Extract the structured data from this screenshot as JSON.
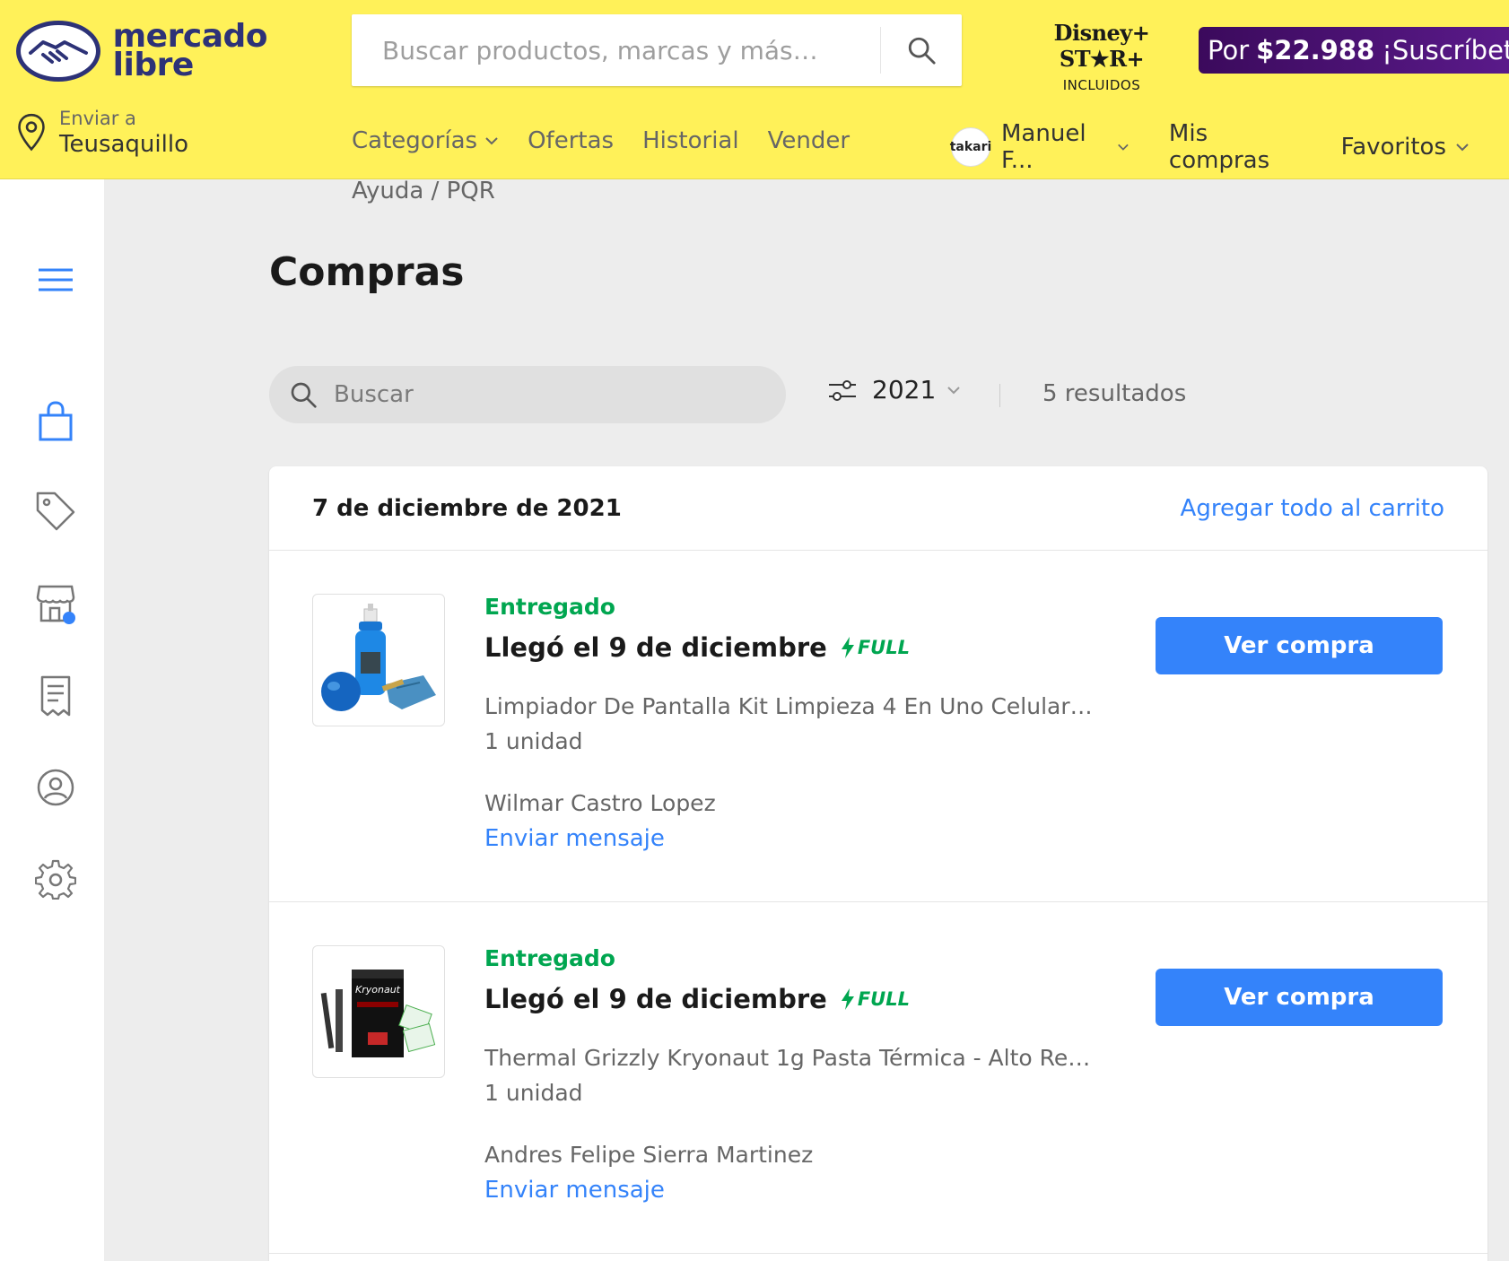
{
  "header": {
    "logo": {
      "line1": "mercado",
      "line2": "libre"
    },
    "search_placeholder": "Buscar productos, marcas y más…",
    "disney": {
      "brand": "Disney+ ST★R+",
      "included": "INCLUIDOS"
    },
    "promo": {
      "prefix": "Por",
      "price": "$22.988",
      "cta": "¡Suscríbete"
    },
    "ship": {
      "label": "Enviar a",
      "location": "Teusaquillo"
    },
    "nav": [
      "Categorías",
      "Ofertas",
      "Historial",
      "Vender"
    ],
    "help": "Ayuda / PQR",
    "user": {
      "avatar_text": "takari",
      "name": "Manuel F..."
    },
    "my_purchases": "Mis compras",
    "favorites": "Favoritos"
  },
  "page": {
    "title": "Compras",
    "search_placeholder": "Buscar",
    "year": "2021",
    "results": "5 resultados"
  },
  "group": {
    "date": "7 de diciembre de 2021",
    "add_all": "Agregar todo al carrito",
    "orders": [
      {
        "status": "Entregado",
        "arrival": "Llegó el 9 de diciembre",
        "badge": "FULL",
        "product": "Limpiador De Pantalla Kit Limpieza 4 En Uno Celular, ...",
        "qty": "1 unidad",
        "seller": "Wilmar Castro Lopez",
        "message": "Enviar mensaje",
        "button": "Ver compra"
      },
      {
        "status": "Entregado",
        "arrival": "Llegó el 9 de diciembre",
        "badge": "FULL",
        "product": "Thermal Grizzly Kryonaut 1g Pasta Térmica - Alto Ren...",
        "qty": "1 unidad",
        "seller": "Andres Felipe Sierra Martinez",
        "message": "Enviar mensaje",
        "button": "Ver compra"
      }
    ]
  },
  "colors": {
    "header_bg": "#fff159",
    "accent": "#3483fa",
    "success": "#00a650",
    "brand_dark": "#2d3277"
  }
}
